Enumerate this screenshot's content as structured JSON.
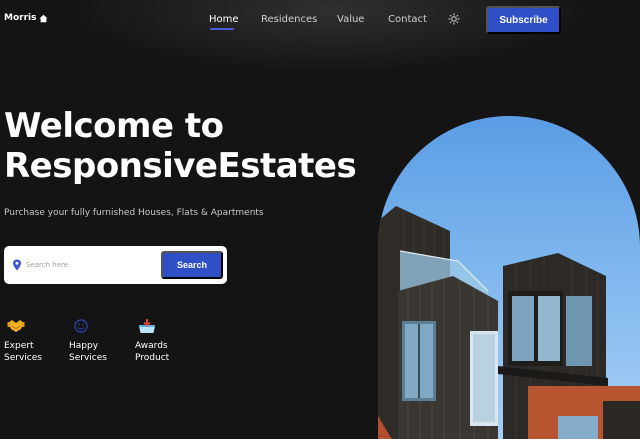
{
  "header": {
    "logo_text": "Morris",
    "logo_icon": "home-icon",
    "nav": [
      {
        "label": "Home",
        "active": true
      },
      {
        "label": "Residences",
        "active": false
      },
      {
        "label": "Value",
        "active": false
      },
      {
        "label": "Contact",
        "active": false
      }
    ],
    "theme_icon": "sun-icon",
    "subscribe_label": "Subscribe"
  },
  "hero": {
    "title_line1": "Welcome to",
    "title_line2": "ResponsiveEstates",
    "subtitle": "Purchase your fully furnished Houses, Flats & Apartments"
  },
  "search": {
    "icon": "location-pin-icon",
    "placeholder": "Search here",
    "value": "",
    "button_label": "Search"
  },
  "features": [
    {
      "icon": "handshake-icon",
      "line1": "Expert",
      "line2": "Services"
    },
    {
      "icon": "smile-icon",
      "line1": "Happy",
      "line2": "Services"
    },
    {
      "icon": "award-box-icon",
      "line1": "Awards",
      "line2": "Product"
    }
  ],
  "colors": {
    "background": "#141414",
    "accent": "#2f4fc7",
    "text": "#ffffff"
  }
}
